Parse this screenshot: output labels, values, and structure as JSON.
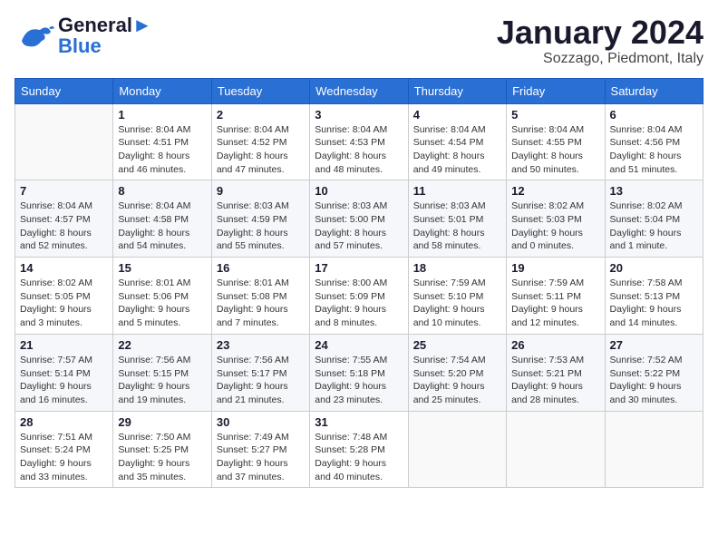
{
  "logo": {
    "text1": "General",
    "text2": "Blue"
  },
  "title": "January 2024",
  "location": "Sozzago, Piedmont, Italy",
  "days_header": [
    "Sunday",
    "Monday",
    "Tuesday",
    "Wednesday",
    "Thursday",
    "Friday",
    "Saturday"
  ],
  "weeks": [
    [
      {
        "num": "",
        "info": ""
      },
      {
        "num": "1",
        "info": "Sunrise: 8:04 AM\nSunset: 4:51 PM\nDaylight: 8 hours\nand 46 minutes."
      },
      {
        "num": "2",
        "info": "Sunrise: 8:04 AM\nSunset: 4:52 PM\nDaylight: 8 hours\nand 47 minutes."
      },
      {
        "num": "3",
        "info": "Sunrise: 8:04 AM\nSunset: 4:53 PM\nDaylight: 8 hours\nand 48 minutes."
      },
      {
        "num": "4",
        "info": "Sunrise: 8:04 AM\nSunset: 4:54 PM\nDaylight: 8 hours\nand 49 minutes."
      },
      {
        "num": "5",
        "info": "Sunrise: 8:04 AM\nSunset: 4:55 PM\nDaylight: 8 hours\nand 50 minutes."
      },
      {
        "num": "6",
        "info": "Sunrise: 8:04 AM\nSunset: 4:56 PM\nDaylight: 8 hours\nand 51 minutes."
      }
    ],
    [
      {
        "num": "7",
        "info": "Sunrise: 8:04 AM\nSunset: 4:57 PM\nDaylight: 8 hours\nand 52 minutes."
      },
      {
        "num": "8",
        "info": "Sunrise: 8:04 AM\nSunset: 4:58 PM\nDaylight: 8 hours\nand 54 minutes."
      },
      {
        "num": "9",
        "info": "Sunrise: 8:03 AM\nSunset: 4:59 PM\nDaylight: 8 hours\nand 55 minutes."
      },
      {
        "num": "10",
        "info": "Sunrise: 8:03 AM\nSunset: 5:00 PM\nDaylight: 8 hours\nand 57 minutes."
      },
      {
        "num": "11",
        "info": "Sunrise: 8:03 AM\nSunset: 5:01 PM\nDaylight: 8 hours\nand 58 minutes."
      },
      {
        "num": "12",
        "info": "Sunrise: 8:02 AM\nSunset: 5:03 PM\nDaylight: 9 hours\nand 0 minutes."
      },
      {
        "num": "13",
        "info": "Sunrise: 8:02 AM\nSunset: 5:04 PM\nDaylight: 9 hours\nand 1 minute."
      }
    ],
    [
      {
        "num": "14",
        "info": "Sunrise: 8:02 AM\nSunset: 5:05 PM\nDaylight: 9 hours\nand 3 minutes."
      },
      {
        "num": "15",
        "info": "Sunrise: 8:01 AM\nSunset: 5:06 PM\nDaylight: 9 hours\nand 5 minutes."
      },
      {
        "num": "16",
        "info": "Sunrise: 8:01 AM\nSunset: 5:08 PM\nDaylight: 9 hours\nand 7 minutes."
      },
      {
        "num": "17",
        "info": "Sunrise: 8:00 AM\nSunset: 5:09 PM\nDaylight: 9 hours\nand 8 minutes."
      },
      {
        "num": "18",
        "info": "Sunrise: 7:59 AM\nSunset: 5:10 PM\nDaylight: 9 hours\nand 10 minutes."
      },
      {
        "num": "19",
        "info": "Sunrise: 7:59 AM\nSunset: 5:11 PM\nDaylight: 9 hours\nand 12 minutes."
      },
      {
        "num": "20",
        "info": "Sunrise: 7:58 AM\nSunset: 5:13 PM\nDaylight: 9 hours\nand 14 minutes."
      }
    ],
    [
      {
        "num": "21",
        "info": "Sunrise: 7:57 AM\nSunset: 5:14 PM\nDaylight: 9 hours\nand 16 minutes."
      },
      {
        "num": "22",
        "info": "Sunrise: 7:56 AM\nSunset: 5:15 PM\nDaylight: 9 hours\nand 19 minutes."
      },
      {
        "num": "23",
        "info": "Sunrise: 7:56 AM\nSunset: 5:17 PM\nDaylight: 9 hours\nand 21 minutes."
      },
      {
        "num": "24",
        "info": "Sunrise: 7:55 AM\nSunset: 5:18 PM\nDaylight: 9 hours\nand 23 minutes."
      },
      {
        "num": "25",
        "info": "Sunrise: 7:54 AM\nSunset: 5:20 PM\nDaylight: 9 hours\nand 25 minutes."
      },
      {
        "num": "26",
        "info": "Sunrise: 7:53 AM\nSunset: 5:21 PM\nDaylight: 9 hours\nand 28 minutes."
      },
      {
        "num": "27",
        "info": "Sunrise: 7:52 AM\nSunset: 5:22 PM\nDaylight: 9 hours\nand 30 minutes."
      }
    ],
    [
      {
        "num": "28",
        "info": "Sunrise: 7:51 AM\nSunset: 5:24 PM\nDaylight: 9 hours\nand 33 minutes."
      },
      {
        "num": "29",
        "info": "Sunrise: 7:50 AM\nSunset: 5:25 PM\nDaylight: 9 hours\nand 35 minutes."
      },
      {
        "num": "30",
        "info": "Sunrise: 7:49 AM\nSunset: 5:27 PM\nDaylight: 9 hours\nand 37 minutes."
      },
      {
        "num": "31",
        "info": "Sunrise: 7:48 AM\nSunset: 5:28 PM\nDaylight: 9 hours\nand 40 minutes."
      },
      {
        "num": "",
        "info": ""
      },
      {
        "num": "",
        "info": ""
      },
      {
        "num": "",
        "info": ""
      }
    ]
  ]
}
